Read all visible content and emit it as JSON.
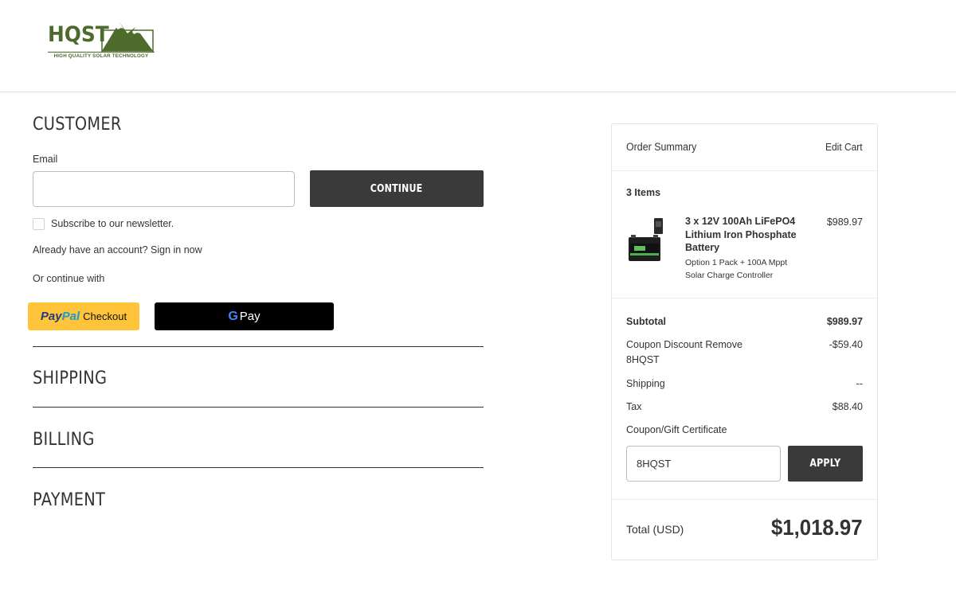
{
  "brand": {
    "name": "HQST",
    "tagline": "HIGH QUALITY SOLAR TECHNOLOGY",
    "color": "#4d6b2a"
  },
  "customer": {
    "title": "CUSTOMER",
    "email_label": "Email",
    "email_value": "",
    "continue_label": "CONTINUE",
    "newsletter_label": "Subscribe to our newsletter.",
    "newsletter_checked": false,
    "account_prompt": "Already have an account?",
    "sign_in_label": "Sign in now",
    "or_continue": "Or continue with",
    "paypal": {
      "part1": "Pay",
      "part2": "Pal",
      "suffix": "Checkout"
    },
    "gpay": {
      "g": "G",
      "label": "Pay"
    }
  },
  "steps": {
    "shipping": "SHIPPING",
    "billing": "BILLING",
    "payment": "PAYMENT"
  },
  "summary": {
    "title": "Order Summary",
    "edit_cart": "Edit Cart",
    "item_count": "3 Items",
    "item": {
      "name": "3 x 12V 100Ah LiFePO4 Lithium Iron Phosphate Battery",
      "option": "Option 1 Pack + 100A Mppt Solar Charge Controller",
      "price": "$989.97"
    },
    "subtotal_label": "Subtotal",
    "subtotal_value": "$989.97",
    "discount_label": "Coupon Discount",
    "discount_remove": "Remove",
    "discount_code": "8HQST",
    "discount_value": "-$59.40",
    "shipping_label": "Shipping",
    "shipping_value": "--",
    "tax_label": "Tax",
    "tax_value": "$88.40",
    "coupon_label": "Coupon/Gift Certificate",
    "coupon_value": "8HQST",
    "apply_label": "APPLY",
    "total_label": "Total (USD)",
    "total_value": "$1,018.97"
  },
  "colors": {
    "button_dark": "#3a3a3a",
    "paypal_yellow": "#ffc439",
    "gpay_black": "#000000"
  }
}
